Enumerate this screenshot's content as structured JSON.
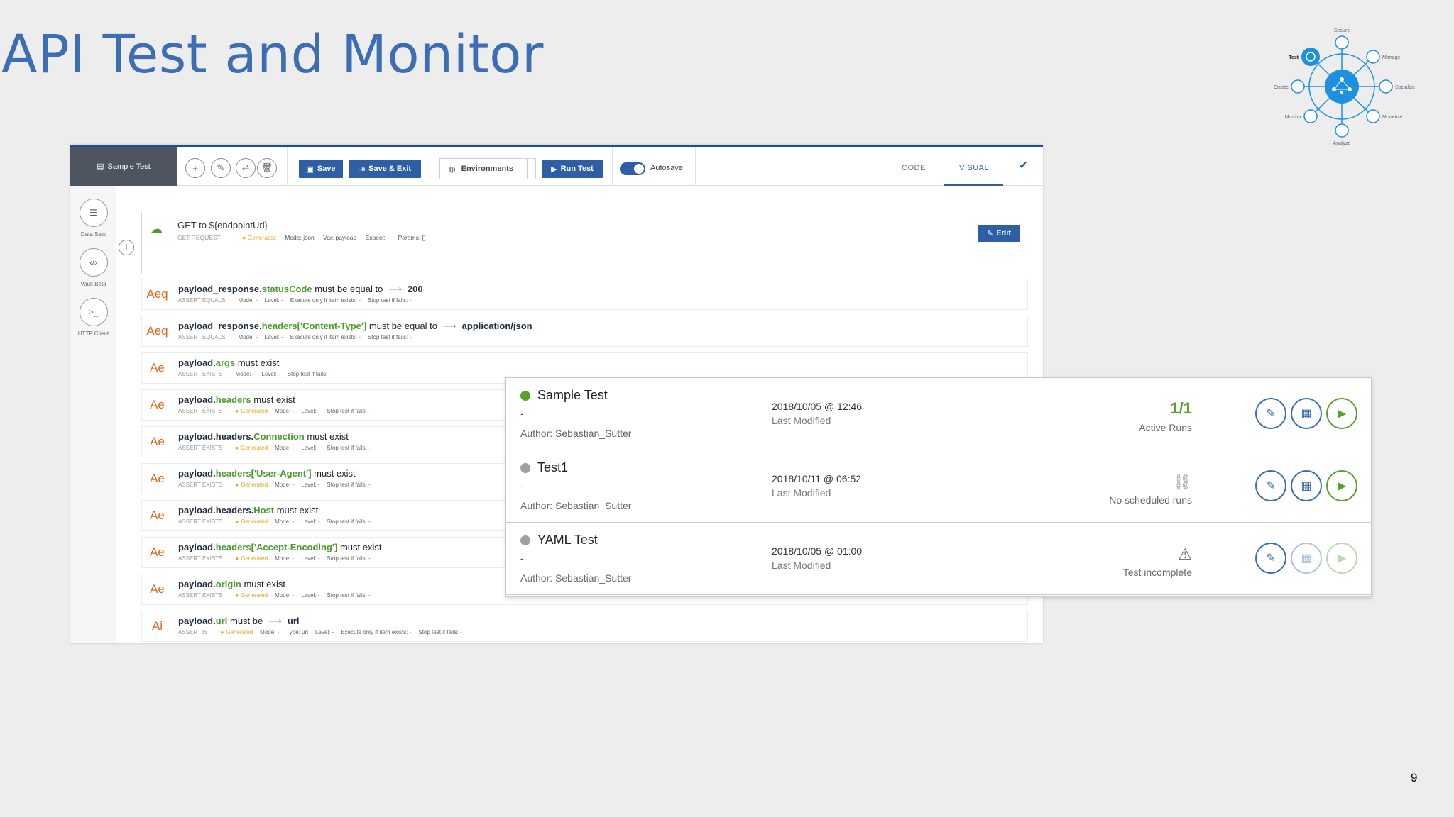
{
  "slide": {
    "title": "API Test and Monitor",
    "page_number": "9"
  },
  "lifecycle": {
    "stages": [
      "Secure",
      "Manage",
      "Socialize",
      "Monetize",
      "Analyze",
      "Monitor",
      "Create",
      "Test"
    ],
    "active_stage": "Test",
    "accent": "#1f8fe0"
  },
  "toolbar": {
    "active_tab": "Sample Test",
    "save_label": "Save",
    "save_exit_label": "Save & Exit",
    "environments_label": "Environments",
    "run_label": "Run Test",
    "autosave_label": "Autosave",
    "autosave_on": true,
    "code_tab": "CODE",
    "visual_tab": "VISUAL",
    "active_view": "VISUAL"
  },
  "rail": {
    "items": [
      {
        "label": "Data Sets",
        "icon": "list-icon"
      },
      {
        "label": "Vault Beta",
        "icon": "code-icon"
      },
      {
        "label": "HTTP Client",
        "icon": "terminal-icon"
      }
    ]
  },
  "request": {
    "title": "GET to ${endpointUrl}",
    "type": "GET REQUEST",
    "generated": "Generated",
    "mode": "Mode: json",
    "var": "Var: payload",
    "expect": "Expect: -",
    "params": "Params: []",
    "edit_label": "Edit"
  },
  "assertions": [
    {
      "code": "Aeq",
      "base": "payload_response.",
      "prop": "statusCode",
      "rest": " must be equal to",
      "value": "200",
      "type": "ASSERT EQUALS",
      "generated": "",
      "meta": [
        "Mode: -",
        "Level: -",
        "Execute only if item exists: -",
        "Stop test if fails: -"
      ]
    },
    {
      "code": "Aeq",
      "base": "payload_response.",
      "prop": "headers['Content-Type']",
      "rest": " must be equal to",
      "value": "application/json",
      "type": "ASSERT EQUALS",
      "generated": "",
      "meta": [
        "Mode: -",
        "Level: -",
        "Execute only if item exists: -",
        "Stop test if fails: -"
      ]
    },
    {
      "code": "Ae",
      "base": "payload.",
      "prop": "args",
      "rest": " must exist",
      "value": "",
      "type": "ASSERT EXISTS",
      "generated": "",
      "meta": [
        "Mode: -",
        "Level: -",
        "Stop test if fails: -"
      ]
    },
    {
      "code": "Ae",
      "base": "payload.",
      "prop": "headers",
      "rest": " must exist",
      "value": "",
      "type": "ASSERT EXISTS",
      "generated": "Generated",
      "meta": [
        "Mode: -",
        "Level: -",
        "Stop test if fails: -"
      ]
    },
    {
      "code": "Ae",
      "base": "payload.headers.",
      "prop": "Connection",
      "rest": " must exist",
      "value": "",
      "type": "ASSERT EXISTS",
      "generated": "Generated",
      "meta": [
        "Mode: -",
        "Level: -",
        "Stop test if fails: -"
      ]
    },
    {
      "code": "Ae",
      "base": "payload.",
      "prop": "headers['User-Agent']",
      "rest": " must exist",
      "value": "",
      "type": "ASSERT EXISTS",
      "generated": "Generated",
      "meta": [
        "Mode: -",
        "Level: -",
        "Stop test if fails: -"
      ]
    },
    {
      "code": "Ae",
      "base": "payload.headers.",
      "prop": "Host",
      "rest": " must exist",
      "value": "",
      "type": "ASSERT EXISTS",
      "generated": "Generated",
      "meta": [
        "Mode: -",
        "Level: -",
        "Stop test if fails: -"
      ]
    },
    {
      "code": "Ae",
      "base": "payload.",
      "prop": "headers['Accept-Encoding']",
      "rest": " must exist",
      "value": "",
      "type": "ASSERT EXISTS",
      "generated": "Generated",
      "meta": [
        "Mode: -",
        "Level: -",
        "Stop test if fails: -"
      ]
    },
    {
      "code": "Ae",
      "base": "payload.",
      "prop": "origin",
      "rest": " must exist",
      "value": "",
      "type": "ASSERT EXISTS",
      "generated": "Generated",
      "meta": [
        "Mode: -",
        "Level: -",
        "Stop test if fails: -"
      ]
    },
    {
      "code": "Ai",
      "base": "payload.",
      "prop": "url",
      "rest": " must be",
      "value": "url",
      "type": "ASSERT IS",
      "generated": "Generated",
      "meta": [
        "Mode: -",
        "Type: url",
        "Level: -",
        "Execute only if item exists: -",
        "Stop test if fails: -"
      ]
    }
  ],
  "tests": [
    {
      "name": "Sample Test",
      "dot_color": "#5aa02c",
      "dash": "-",
      "author": "Author: Sebastian_Sutter",
      "date": "2018/10/05 @ 12:46",
      "date_label": "Last Modified",
      "status_value": "1/1",
      "status_icon": "",
      "status_label": "Active Runs",
      "run_enabled": true,
      "schedule_enabled": true
    },
    {
      "name": "Test1",
      "dot_color": "#a0a0a0",
      "dash": "-",
      "author": "Author: Sebastian_Sutter",
      "date": "2018/10/11 @ 06:52",
      "date_label": "Last Modified",
      "status_value": "",
      "status_icon": "broken-link-icon",
      "status_label": "No scheduled runs",
      "run_enabled": true,
      "schedule_enabled": true
    },
    {
      "name": "YAML Test",
      "dot_color": "#a0a0a0",
      "dash": "-",
      "author": "Author: Sebastian_Sutter",
      "date": "2018/10/05 @ 01:00",
      "date_label": "Last Modified",
      "status_value": "",
      "status_icon": "warning-icon",
      "status_label": "Test incomplete",
      "run_enabled": false,
      "schedule_enabled": false
    }
  ]
}
